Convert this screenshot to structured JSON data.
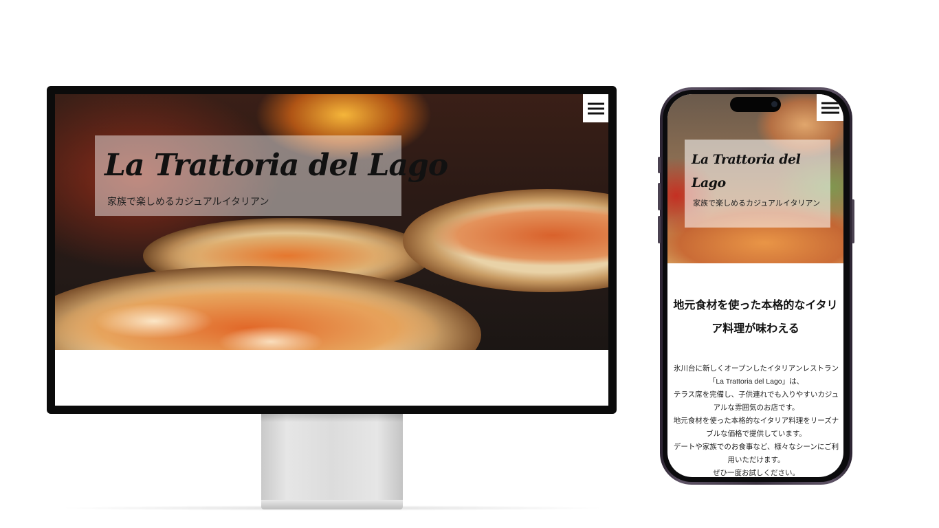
{
  "site": {
    "logo": "La Trattoria del Lago",
    "tagline": "家族で楽しめるカジュアルイタリアン",
    "menu_icon": "hamburger-icon"
  },
  "mobile": {
    "logo": "La Trattoria del Lago",
    "tagline": "家族で楽しめるカジュアルイタリアン",
    "heading": "地元食材を使った本格的なイタリア料理が味わえる",
    "paragraphs": [
      "氷川台に新しくオープンしたイタリアンレストラン",
      "「La Trattoria del Lago」は、",
      "テラス席を完備し、子供連れでも入りやすいカジュアルな雰囲気のお店です。",
      "地元食材を使った本格的なイタリア料理をリーズナブルな価格で提供しています。",
      "デートや家族でのお食事など、様々なシーンにご利用いただけます。",
      "ぜひ一度お試しください。"
    ]
  }
}
